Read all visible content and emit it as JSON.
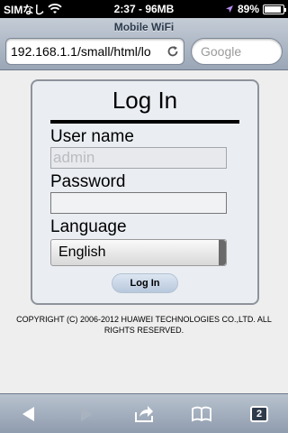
{
  "status_bar": {
    "carrier": "SIMなし",
    "time_label": "2:37 - 96MB",
    "battery_percent": "89%",
    "battery_level": 0.89
  },
  "browser": {
    "page_title": "Mobile WiFi",
    "url": "192.168.1.1/small/html/lo",
    "search_placeholder": "Google"
  },
  "login": {
    "title": "Log In",
    "username_label": "User name",
    "username_placeholder": "admin",
    "password_label": "Password",
    "language_label": "Language",
    "language_selected": "English",
    "login_button": "Log In"
  },
  "footer": {
    "copyright": "COPYRIGHT (C) 2006-2012 HUAWEI TECHNOLOGIES CO.,LTD. ALL RIGHTS RESERVED."
  },
  "toolbar": {
    "tab_count": "2",
    "icons": [
      "back-icon",
      "forward-icon",
      "share-icon",
      "bookmarks-icon",
      "tabs-icon"
    ]
  },
  "colors": {
    "status_bar_bg": "#000000",
    "nav_bar": "#9aa6b6",
    "login_box_bg": "#eaeef3",
    "login_button": "#c8d6e6"
  }
}
